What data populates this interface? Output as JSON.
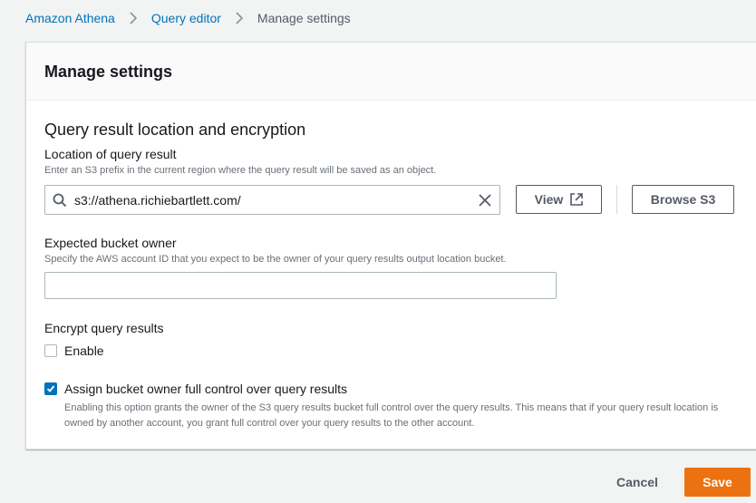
{
  "breadcrumb": {
    "items": [
      "Amazon Athena",
      "Query editor"
    ],
    "current": "Manage settings"
  },
  "panel": {
    "title": "Manage settings",
    "section_title": "Query result location and encryption",
    "location": {
      "label": "Location of query result",
      "description": "Enter an S3 prefix in the current region where the query result will be saved as an object.",
      "value": "s3://athena.richiebartlett.com/",
      "view_label": "View",
      "browse_label": "Browse S3"
    },
    "bucket_owner": {
      "label": "Expected bucket owner",
      "description": "Specify the AWS account ID that you expect to be the owner of your query results output location bucket.",
      "value": ""
    },
    "encrypt": {
      "label": "Encrypt query results",
      "enable_label": "Enable",
      "enabled": false
    },
    "full_control": {
      "label": "Assign bucket owner full control over query results",
      "checked": true,
      "description": "Enabling this option grants the owner of the S3 query results bucket full control over the query results. This means that if your query result location is owned by another account, you grant full control over your query results to the other account."
    }
  },
  "footer": {
    "cancel_label": "Cancel",
    "save_label": "Save"
  },
  "colors": {
    "link": "#0073bb",
    "primary": "#ec7211",
    "checkbox_checked": "#0073bb"
  }
}
